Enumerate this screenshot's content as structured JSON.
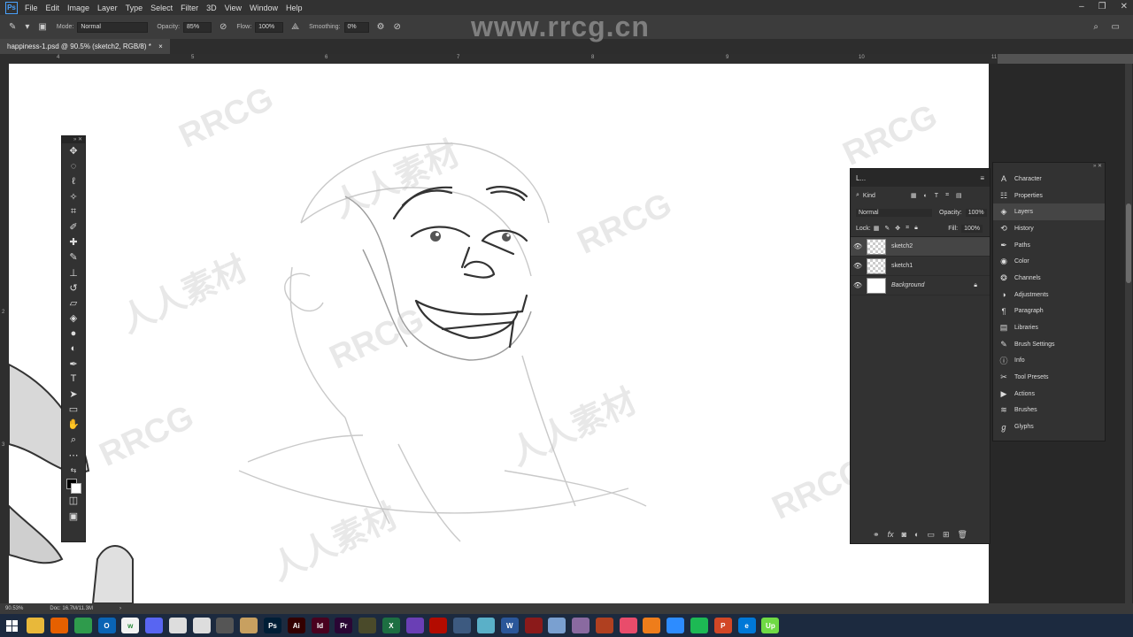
{
  "menubar": {
    "items": [
      "File",
      "Edit",
      "Image",
      "Layer",
      "Type",
      "Select",
      "Filter",
      "3D",
      "View",
      "Window",
      "Help"
    ]
  },
  "options_bar": {
    "mode_label": "Mode:",
    "mode_value": "Normal",
    "opacity_label": "Opacity:",
    "opacity_value": "85%",
    "flow_label": "Flow:",
    "flow_value": "100%",
    "smoothing_label": "Smoothing:",
    "smoothing_value": "0%"
  },
  "document_tab": {
    "title": "happiness-1.psd @ 90.5% (sketch2, RGB/8) *",
    "close": "×"
  },
  "ruler": {
    "top_ticks": [
      "4",
      "5",
      "6",
      "7",
      "8",
      "9",
      "10",
      "11"
    ],
    "left_ticks": [
      "2",
      "3"
    ]
  },
  "watermark": {
    "site": "www.rrcg.cn",
    "tile": "RRCG",
    "tile_cn": "人人素材"
  },
  "layers_panel": {
    "tab_label": "L...",
    "kind_label": "Kind",
    "blend_mode": "Normal",
    "opacity_label": "Opacity:",
    "opacity_value": "100%",
    "lock_label": "Lock:",
    "fill_label": "Fill:",
    "fill_value": "100%",
    "layers": [
      {
        "name": "sketch2",
        "visible": true,
        "selected": true
      },
      {
        "name": "sketch1",
        "visible": true,
        "selected": false
      },
      {
        "name": "Background",
        "visible": true,
        "selected": false,
        "locked": true
      }
    ]
  },
  "side_panels": {
    "items": [
      {
        "label": "Character",
        "icon": "character-icon"
      },
      {
        "label": "Properties",
        "icon": "properties-icon"
      },
      {
        "label": "Layers",
        "icon": "layers-icon"
      },
      {
        "label": "History",
        "icon": "history-icon"
      },
      {
        "label": "Paths",
        "icon": "paths-icon"
      },
      {
        "label": "Color",
        "icon": "color-icon"
      },
      {
        "label": "Channels",
        "icon": "channels-icon"
      },
      {
        "label": "Adjustments",
        "icon": "adjustments-icon"
      },
      {
        "label": "Paragraph",
        "icon": "paragraph-icon"
      },
      {
        "label": "Libraries",
        "icon": "libraries-icon"
      },
      {
        "label": "Brush Settings",
        "icon": "brush-settings-icon"
      },
      {
        "label": "Info",
        "icon": "info-icon"
      },
      {
        "label": "Tool Presets",
        "icon": "tool-presets-icon"
      },
      {
        "label": "Actions",
        "icon": "actions-icon"
      },
      {
        "label": "Brushes",
        "icon": "brushes-icon"
      },
      {
        "label": "Glyphs",
        "icon": "glyphs-icon"
      }
    ],
    "active": "Layers"
  },
  "status_bar": {
    "zoom": "90.53%",
    "doc": "Doc: 16.7M/11.3M"
  },
  "taskbar": {
    "apps": [
      {
        "name": "windows-start-icon",
        "label": "",
        "color": "#1c2a3f"
      },
      {
        "name": "file-explorer-icon",
        "label": "",
        "color": "#e8b83a"
      },
      {
        "name": "firefox-icon",
        "label": "",
        "color": "#e66000"
      },
      {
        "name": "chrome-icon",
        "label": "",
        "color": "#2f9b4c"
      },
      {
        "name": "outlook-icon",
        "label": "O",
        "color": "#0a64b5"
      },
      {
        "name": "w-app-icon",
        "label": "w",
        "color": "#f2f2f2"
      },
      {
        "name": "discord-icon",
        "label": "",
        "color": "#5865f2"
      },
      {
        "name": "app-swirl-icon",
        "label": "",
        "color": "#dddddd"
      },
      {
        "name": "app-knot-icon",
        "label": "",
        "color": "#dddddd"
      },
      {
        "name": "eraser-app-icon",
        "label": "",
        "color": "#555555"
      },
      {
        "name": "pencil-app-icon",
        "label": "",
        "color": "#c8a060"
      },
      {
        "name": "photoshop-icon",
        "label": "Ps",
        "color": "#001e36"
      },
      {
        "name": "illustrator-icon",
        "label": "Ai",
        "color": "#330000"
      },
      {
        "name": "indesign-icon",
        "label": "Id",
        "color": "#49021f"
      },
      {
        "name": "premiere-icon",
        "label": "Pr",
        "color": "#2a0634"
      },
      {
        "name": "star-app-icon",
        "label": "",
        "color": "#4a4a2a"
      },
      {
        "name": "excel-icon",
        "label": "X",
        "color": "#1d6f42"
      },
      {
        "name": "vs-app-icon",
        "label": "",
        "color": "#6a3fb5"
      },
      {
        "name": "acrobat-icon",
        "label": "",
        "color": "#b30b00"
      },
      {
        "name": "cross-app-icon",
        "label": "",
        "color": "#3d5a80"
      },
      {
        "name": "sketch-app-icon",
        "label": "",
        "color": "#5ab0c8"
      },
      {
        "name": "word-icon",
        "label": "W",
        "color": "#2b579a"
      },
      {
        "name": "app-dark-icon",
        "label": "",
        "color": "#8b1a1a"
      },
      {
        "name": "app-photo-icon",
        "label": "",
        "color": "#7aa0d0"
      },
      {
        "name": "app-clip-icon",
        "label": "",
        "color": "#8a6aa0"
      },
      {
        "name": "app-box-icon",
        "label": "",
        "color": "#b04020"
      },
      {
        "name": "itunes-icon",
        "label": "",
        "color": "#e94c6b"
      },
      {
        "name": "vlc-icon",
        "label": "",
        "color": "#ee7d1b"
      },
      {
        "name": "zoom-icon",
        "label": "",
        "color": "#2d8cff"
      },
      {
        "name": "spotify-icon",
        "label": "",
        "color": "#1db954"
      },
      {
        "name": "powerpoint-icon",
        "label": "P",
        "color": "#d24726"
      },
      {
        "name": "edge-icon",
        "label": "e",
        "color": "#0078d7"
      },
      {
        "name": "upwork-icon",
        "label": "Up",
        "color": "#6fda44"
      }
    ]
  }
}
